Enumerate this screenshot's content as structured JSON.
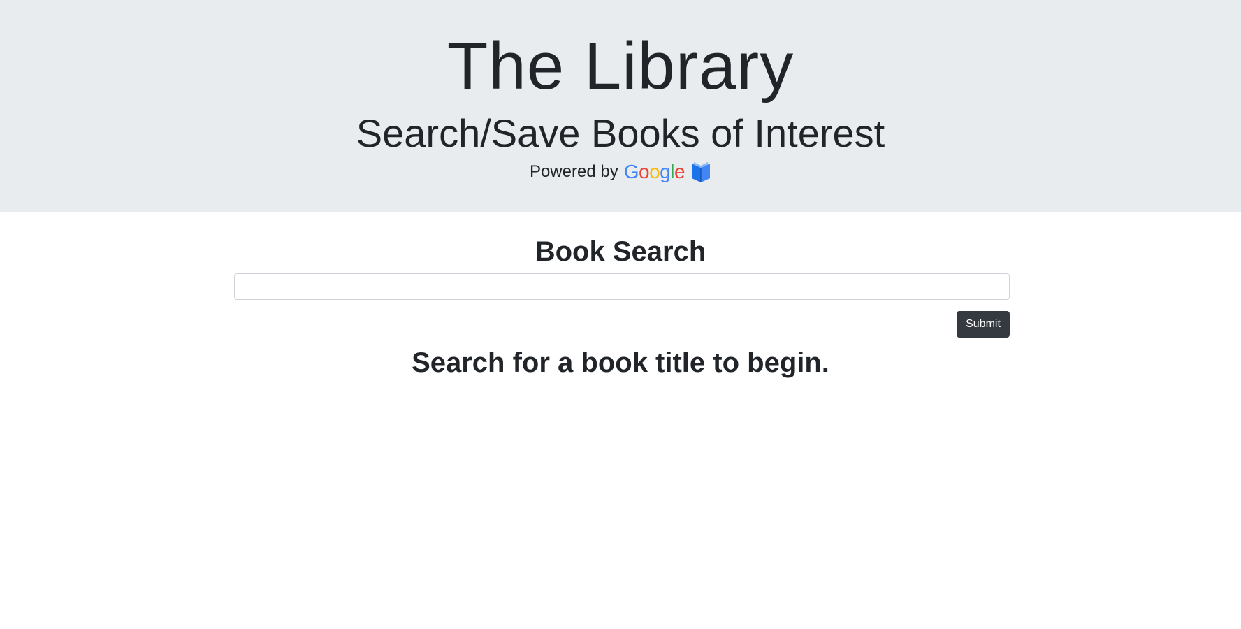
{
  "header": {
    "title": "The Library",
    "subtitle": "Search/Save Books of Interest",
    "powered_by": "Powered by",
    "logo": {
      "G": "G",
      "o1": "o",
      "o2": "o",
      "g": "g",
      "l": "l",
      "e": "e",
      "icon": "book-icon"
    }
  },
  "search": {
    "heading": "Book Search",
    "value": "",
    "submit_label": "Submit"
  },
  "results": {
    "empty_message": "Search for a book title to begin."
  },
  "colors": {
    "header_bg": "#e9ecef",
    "button_bg": "#343a40",
    "text": "#212529",
    "google_blue": "#4285f4",
    "google_red": "#ea4335",
    "google_yellow": "#fbbc05",
    "google_green": "#34a853"
  }
}
